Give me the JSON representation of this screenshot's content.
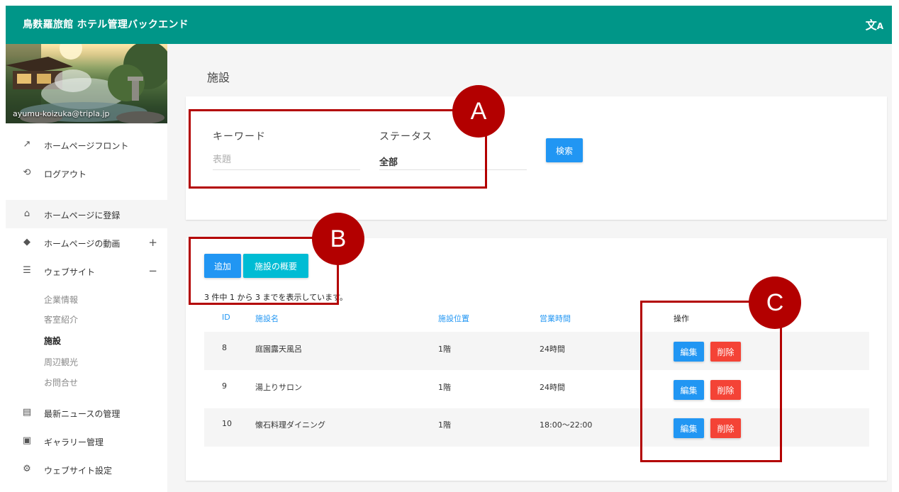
{
  "header": {
    "title": "鳥麩羅旅館 ホテル管理バックエンド",
    "translate_icon": "translate-icon"
  },
  "sidebar": {
    "user_email": "ayumu-koizuka@tripla.jp",
    "menu": [
      {
        "label": "ホームページフロント",
        "icon": "external-link-icon"
      },
      {
        "label": "ログアウト",
        "icon": "history-icon"
      },
      {
        "label": "ホームページに登録",
        "icon": "home-icon"
      },
      {
        "label": "ホームページの動画",
        "icon": "layers-icon",
        "toggle": "+"
      },
      {
        "label": "ウェブサイト",
        "icon": "list-icon",
        "toggle": "−"
      },
      {
        "label": "最新ニュースの管理",
        "icon": "news-icon"
      },
      {
        "label": "ギャラリー管理",
        "icon": "image-icon"
      },
      {
        "label": "ウェブサイト設定",
        "icon": "gear-icon"
      }
    ],
    "website_subitems": [
      "企業情報",
      "客室紹介",
      "施設",
      "周辺観光",
      "お問合せ"
    ],
    "current_subitem": "施設"
  },
  "page": {
    "title": "施設"
  },
  "search": {
    "keyword_label": "キーワード",
    "keyword_placeholder": "表題",
    "keyword_value": "",
    "status_label": "ステータス",
    "status_value": "全部",
    "search_button": "検索"
  },
  "toolbar": {
    "add_button": "追加",
    "overview_button": "施設の概要"
  },
  "table": {
    "record_info": "3 件中 1 から 3 までを表示しています。",
    "columns": [
      "ID",
      "施設名",
      "施設位置",
      "営業時間",
      "操作"
    ],
    "rows": [
      {
        "id": "8",
        "name": "庭園露天風呂",
        "location": "1階",
        "hours": "24時間"
      },
      {
        "id": "9",
        "name": "湯上りサロン",
        "location": "1階",
        "hours": "24時間"
      },
      {
        "id": "10",
        "name": "懐石料理ダイニング",
        "location": "1階",
        "hours": "18:00〜22:00"
      }
    ],
    "edit_label": "編集",
    "delete_label": "削除"
  },
  "annotations": {
    "a": "A",
    "b": "B",
    "c": "C",
    "color": "#b30000"
  },
  "colors": {
    "header": "#009688",
    "primary": "#2196f3",
    "info": "#00bcd4",
    "danger": "#f44336"
  }
}
